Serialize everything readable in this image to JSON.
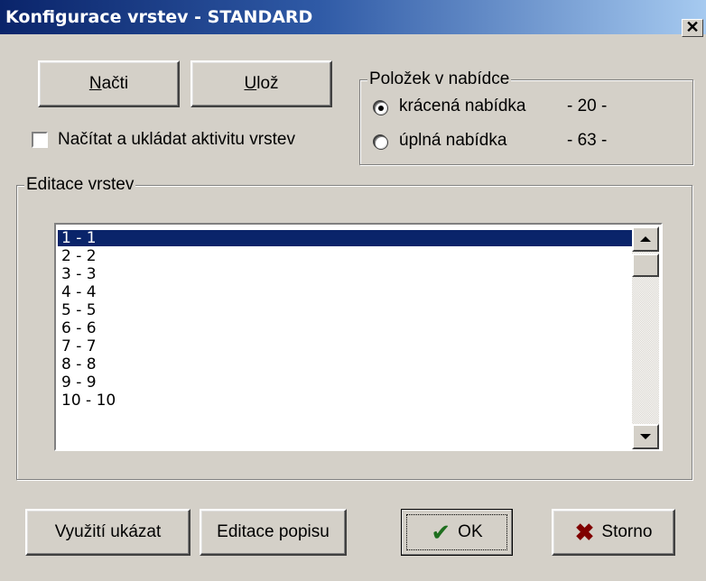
{
  "window": {
    "title": "Konfigurace vrstev - STANDARD",
    "close_glyph": "✕"
  },
  "buttons": {
    "load": {
      "accel": "N",
      "rest": "ačti"
    },
    "save": {
      "accel": "U",
      "rest": "lož"
    },
    "show_usage": "Využití ukázat",
    "edit_description": "Editace popisu",
    "ok": "OK",
    "cancel": "Storno"
  },
  "checkbox": {
    "label": "Načítat a ukládat aktivitu vrstev",
    "checked": false
  },
  "menu_group": {
    "legend": "Položek v nabídce",
    "options": [
      {
        "label": "krácená nabídka",
        "count": "- 20 -",
        "selected": true
      },
      {
        "label": "úplná nabídka",
        "count": "- 63 -",
        "selected": false
      }
    ]
  },
  "layers_group": {
    "legend": "Editace vrstev",
    "items": [
      "1 - 1",
      "2 - 2",
      "3 - 3",
      "4 - 4",
      "5 - 5",
      "6 - 6",
      "7 - 7",
      "8 - 8",
      "9 - 9",
      "10 - 10"
    ],
    "selected_index": 0
  },
  "icons": {
    "ok": "checkmark-icon",
    "cancel": "cross-icon"
  },
  "colors": {
    "ok_icon": "#1e6e1e",
    "cancel_icon": "#800000",
    "selection": "#0a246a"
  }
}
